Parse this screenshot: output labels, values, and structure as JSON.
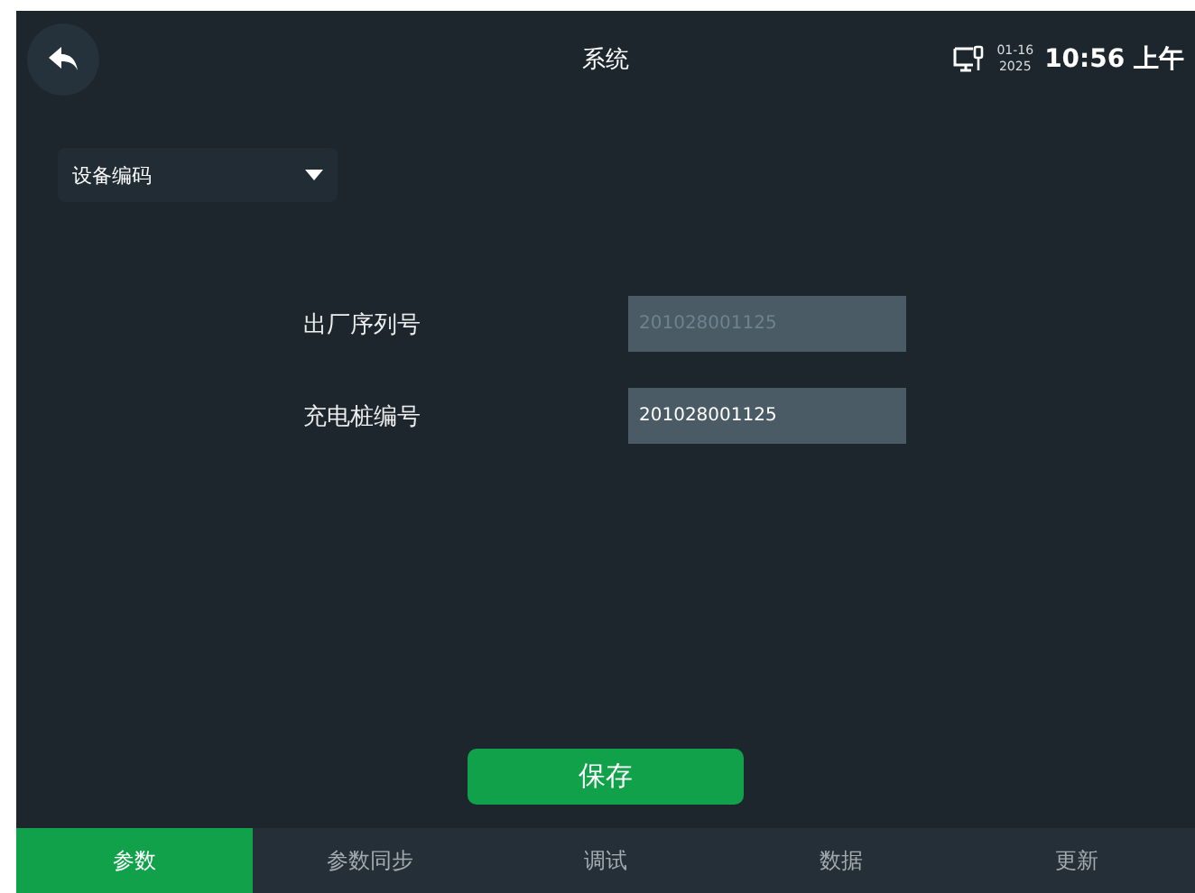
{
  "header": {
    "title": "系统",
    "date_month_day": "01-16",
    "date_year": "2025",
    "time": "10:56 上午"
  },
  "dropdown": {
    "value": "设备编码"
  },
  "fields": [
    {
      "label": "出厂序列号",
      "value": "201028001125",
      "disabled": true
    },
    {
      "label": "充电桩编号",
      "value": "201028001125",
      "disabled": false
    }
  ],
  "save_button": "保存",
  "tabs": [
    {
      "label": "参数",
      "selected": true
    },
    {
      "label": "参数同步",
      "selected": false
    },
    {
      "label": "调试",
      "selected": false
    },
    {
      "label": "数据",
      "selected": false
    },
    {
      "label": "更新",
      "selected": false
    }
  ]
}
